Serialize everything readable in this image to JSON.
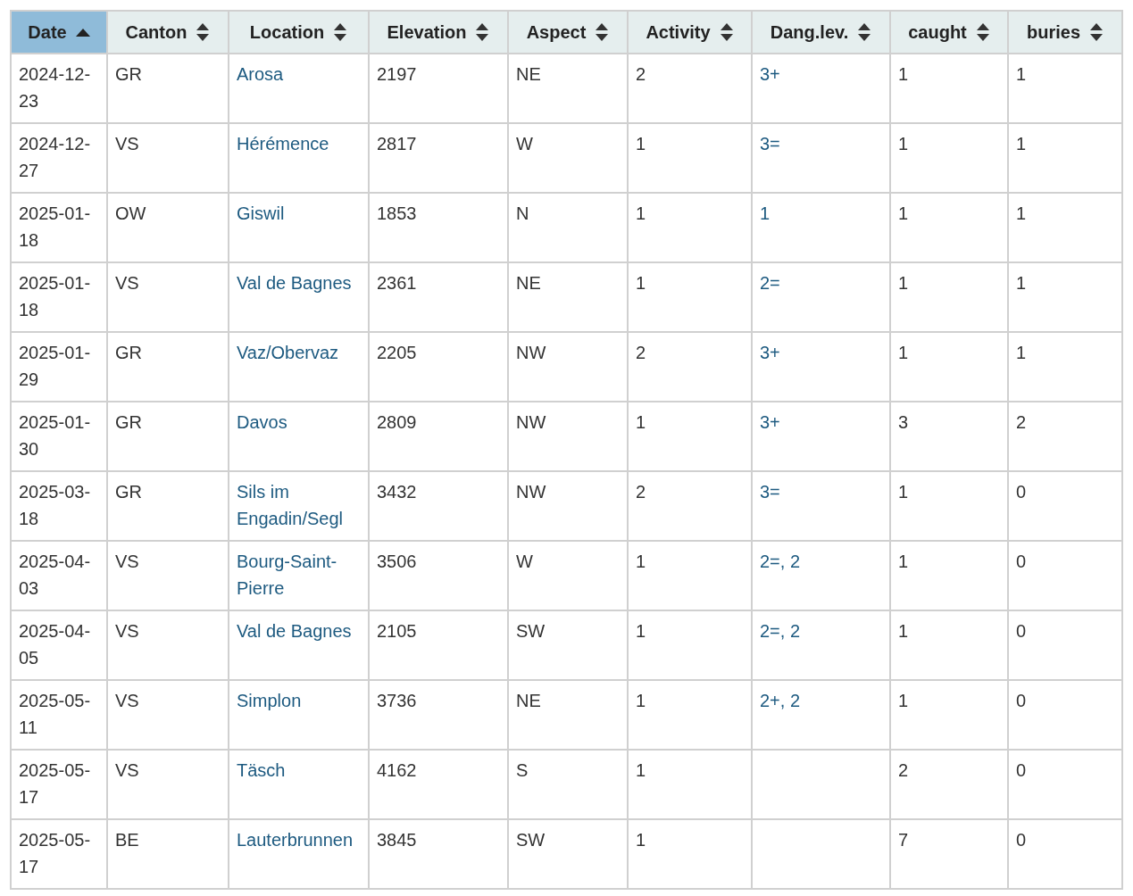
{
  "table": {
    "columns": [
      {
        "label": "Date",
        "sorted": true
      },
      {
        "label": "Canton",
        "sorted": false
      },
      {
        "label": "Location",
        "sorted": false
      },
      {
        "label": "Elevation",
        "sorted": false
      },
      {
        "label": "Aspect",
        "sorted": false
      },
      {
        "label": "Activity",
        "sorted": false
      },
      {
        "label": "Dang.lev.",
        "sorted": false
      },
      {
        "label": "caught",
        "sorted": false
      },
      {
        "label": "buries",
        "sorted": false
      }
    ],
    "rows": [
      {
        "date": "2024-12-23",
        "canton": "GR",
        "location": "Arosa",
        "elevation": "2197",
        "aspect": "NE",
        "activity": "2",
        "danger_level": "3+",
        "caught": "1",
        "buries": "1"
      },
      {
        "date": "2024-12-27",
        "canton": "VS",
        "location": "Hérémence",
        "elevation": "2817",
        "aspect": "W",
        "activity": "1",
        "danger_level": "3=",
        "caught": "1",
        "buries": "1"
      },
      {
        "date": "2025-01-18",
        "canton": "OW",
        "location": "Giswil",
        "elevation": "1853",
        "aspect": "N",
        "activity": "1",
        "danger_level": "1",
        "caught": "1",
        "buries": "1"
      },
      {
        "date": "2025-01-18",
        "canton": "VS",
        "location": "Val de Bagnes",
        "elevation": "2361",
        "aspect": "NE",
        "activity": "1",
        "danger_level": "2=",
        "caught": "1",
        "buries": "1"
      },
      {
        "date": "2025-01-29",
        "canton": "GR",
        "location": "Vaz/Obervaz",
        "elevation": "2205",
        "aspect": "NW",
        "activity": "2",
        "danger_level": "3+",
        "caught": "1",
        "buries": "1"
      },
      {
        "date": "2025-01-30",
        "canton": "GR",
        "location": "Davos",
        "elevation": "2809",
        "aspect": "NW",
        "activity": "1",
        "danger_level": "3+",
        "caught": "3",
        "buries": "2"
      },
      {
        "date": "2025-03-18",
        "canton": "GR",
        "location": "Sils im Engadin/Segl",
        "elevation": "3432",
        "aspect": "NW",
        "activity": "2",
        "danger_level": "3=",
        "caught": "1",
        "buries": "0"
      },
      {
        "date": "2025-04-03",
        "canton": "VS",
        "location": "Bourg-Saint-Pierre",
        "elevation": "3506",
        "aspect": "W",
        "activity": "1",
        "danger_level": "2=, 2",
        "caught": "1",
        "buries": "0"
      },
      {
        "date": "2025-04-05",
        "canton": "VS",
        "location": "Val de Bagnes",
        "elevation": "2105",
        "aspect": "SW",
        "activity": "1",
        "danger_level": "2=, 2",
        "caught": "1",
        "buries": "0"
      },
      {
        "date": "2025-05-11",
        "canton": "VS",
        "location": "Simplon",
        "elevation": "3736",
        "aspect": "NE",
        "activity": "1",
        "danger_level": "2+, 2",
        "caught": "1",
        "buries": "0"
      },
      {
        "date": "2025-05-17",
        "canton": "VS",
        "location": "Täsch",
        "elevation": "4162",
        "aspect": "S",
        "activity": "1",
        "caught": "2",
        "buries": "0"
      },
      {
        "date": "2025-05-17",
        "canton": "BE",
        "location": "Lauterbrunnen",
        "elevation": "3845",
        "aspect": "SW",
        "activity": "1",
        "caught": "7",
        "buries": "0"
      }
    ]
  }
}
